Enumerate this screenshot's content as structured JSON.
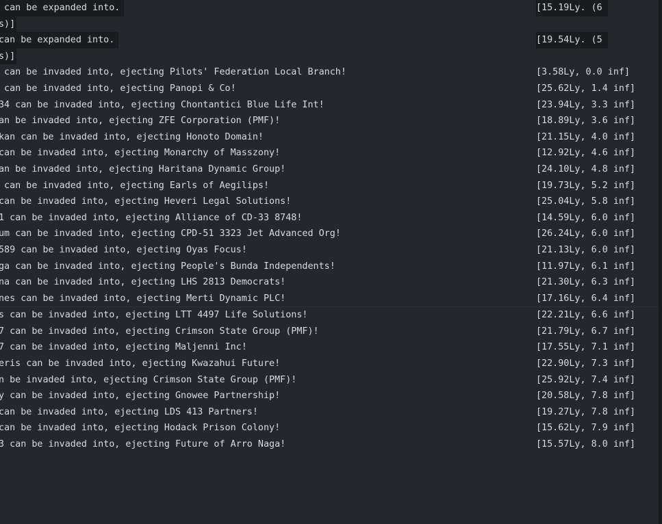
{
  "lines": [
    {
      "text": " can be expanded into.",
      "dist": "[15.19Ly. (6",
      "hl": true
    },
    {
      "text": "s)]",
      "dist": "",
      "hl": true,
      "cont": true
    },
    {
      "text": "can be expanded into.",
      "dist": "[19.54Ly. (5",
      "hl": true
    },
    {
      "text": "s)]",
      "dist": "",
      "hl": true,
      "cont": true
    },
    {
      "text": " can be invaded into, ejecting Pilots' Federation Local Branch!",
      "dist": "[3.58Ly, 0.0 inf]"
    },
    {
      "text": " can be invaded into, ejecting Panopi & Co!",
      "dist": "[25.62Ly, 1.4 inf]"
    },
    {
      "text": "34 can be invaded into, ejecting Chontantici Blue Life Int!",
      "dist": "[23.94Ly, 3.3 inf]"
    },
    {
      "text": "an be invaded into, ejecting ZFE Corporation (PMF)!",
      "dist": "[18.89Ly, 3.6 inf]"
    },
    {
      "text": "kan can be invaded into, ejecting Honoto Domain!",
      "dist": "[21.15Ly, 4.0 inf]"
    },
    {
      "text": "can be invaded into, ejecting Monarchy of Masszony!",
      "dist": "[12.92Ly, 4.6 inf]"
    },
    {
      "text": "an be invaded into, ejecting Haritana Dynamic Group!",
      "dist": "[24.10Ly, 4.8 inf]"
    },
    {
      "text": " can be invaded into, ejecting Earls of Aegilips!",
      "dist": "[19.73Ly, 5.2 inf]"
    },
    {
      "text": "can be invaded into, ejecting Heveri Legal Solutions!",
      "dist": "[25.04Ly, 5.8 inf]"
    },
    {
      "text": "1 can be invaded into, ejecting Alliance of CD-33 8748!",
      "dist": "[14.59Ly, 6.0 inf]"
    },
    {
      "text": "um can be invaded into, ejecting CPD-51 3323 Jet Advanced Org!",
      "dist": "[26.24Ly, 6.0 inf]"
    },
    {
      "text": "589 can be invaded into, ejecting Oyas Focus!",
      "dist": "[21.13Ly, 6.0 inf]"
    },
    {
      "text": "ga can be invaded into, ejecting People's Bunda Independents!",
      "dist": "[11.97Ly, 6.1 inf]"
    },
    {
      "text": "na can be invaded into, ejecting LHS 2813 Democrats!",
      "dist": "[21.30Ly, 6.3 inf]"
    },
    {
      "text": "nes can be invaded into, ejecting Merti Dynamic PLC!",
      "dist": "[17.16Ly, 6.4 inf]"
    },
    {
      "text": "s can be invaded into, ejecting LTT 4497 Life Solutions!",
      "dist": "[22.21Ly, 6.6 inf]"
    },
    {
      "text": "7 can be invaded into, ejecting Crimson State Group (PMF)!",
      "dist": "[21.79Ly, 6.7 inf]"
    },
    {
      "text": "7 can be invaded into, ejecting Maljenni Inc!",
      "dist": "[17.55Ly, 7.1 inf]"
    },
    {
      "text": "eris can be invaded into, ejecting Kwazahui Future!",
      "dist": "[22.90Ly, 7.3 inf]"
    },
    {
      "text": "n be invaded into, ejecting Crimson State Group (PMF)!",
      "dist": "[25.92Ly, 7.4 inf]"
    },
    {
      "text": "y can be invaded into, ejecting Gnowee Partnership!",
      "dist": "[20.58Ly, 7.8 inf]"
    },
    {
      "text": "can be invaded into, ejecting LDS 413 Partners!",
      "dist": "[19.27Ly, 7.8 inf]"
    },
    {
      "text": "can be invaded into, ejecting Hodack Prison Colony!",
      "dist": "[15.62Ly, 7.9 inf]"
    },
    {
      "text": "3 can be invaded into, ejecting Future of Arro Naga!",
      "dist": "[15.57Ly, 8.0 inf]"
    }
  ]
}
